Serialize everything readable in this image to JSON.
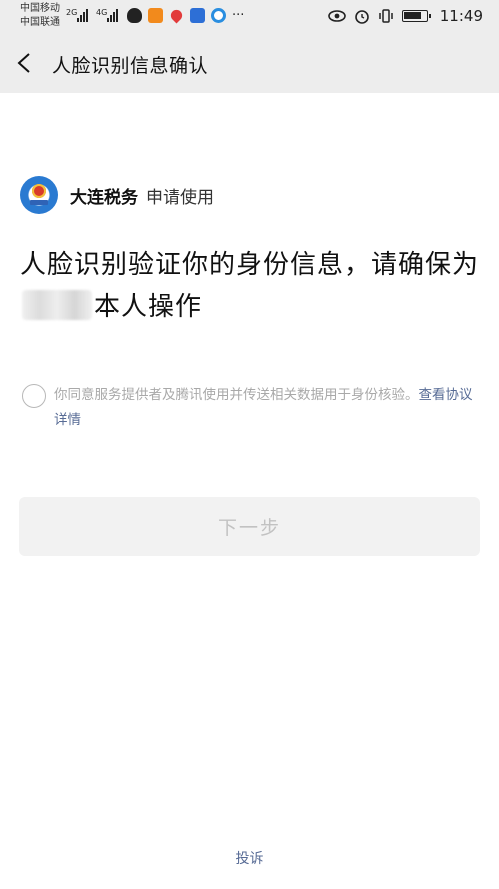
{
  "status_bar": {
    "carrier_1": "中国移动",
    "carrier_2": "中国联通",
    "sig1_tag": "2G",
    "sig2_tag": "4G",
    "more": "···",
    "time": "11:49",
    "icons": [
      "qq-icon",
      "video-icon",
      "location-pin-icon",
      "news-app-icon",
      "browser-icon",
      "eye-icon",
      "alarm-icon",
      "vibrate-icon",
      "battery-icon"
    ]
  },
  "nav": {
    "title": "人脸识别信息确认",
    "back_icon": "chevron-left-icon"
  },
  "app": {
    "name": "大连税务",
    "action": "申请使用",
    "logo_icon": "tax-emblem-icon"
  },
  "headline": {
    "part1": "人脸识别验证你的身份信息，请确保为",
    "part2": "本人操作"
  },
  "agreement": {
    "text": "你同意服务提供者及腾讯使用并传送相关数据用于身份核验。",
    "link": "查看协议详情",
    "checked": false
  },
  "next_button": {
    "label": "下一步",
    "enabled": false
  },
  "footer": {
    "complain": "投诉"
  },
  "colors": {
    "link": "#576b95",
    "nav_bg": "#ededed",
    "button_bg": "#f2f2f2",
    "button_text_disabled": "#c2c2c2"
  }
}
